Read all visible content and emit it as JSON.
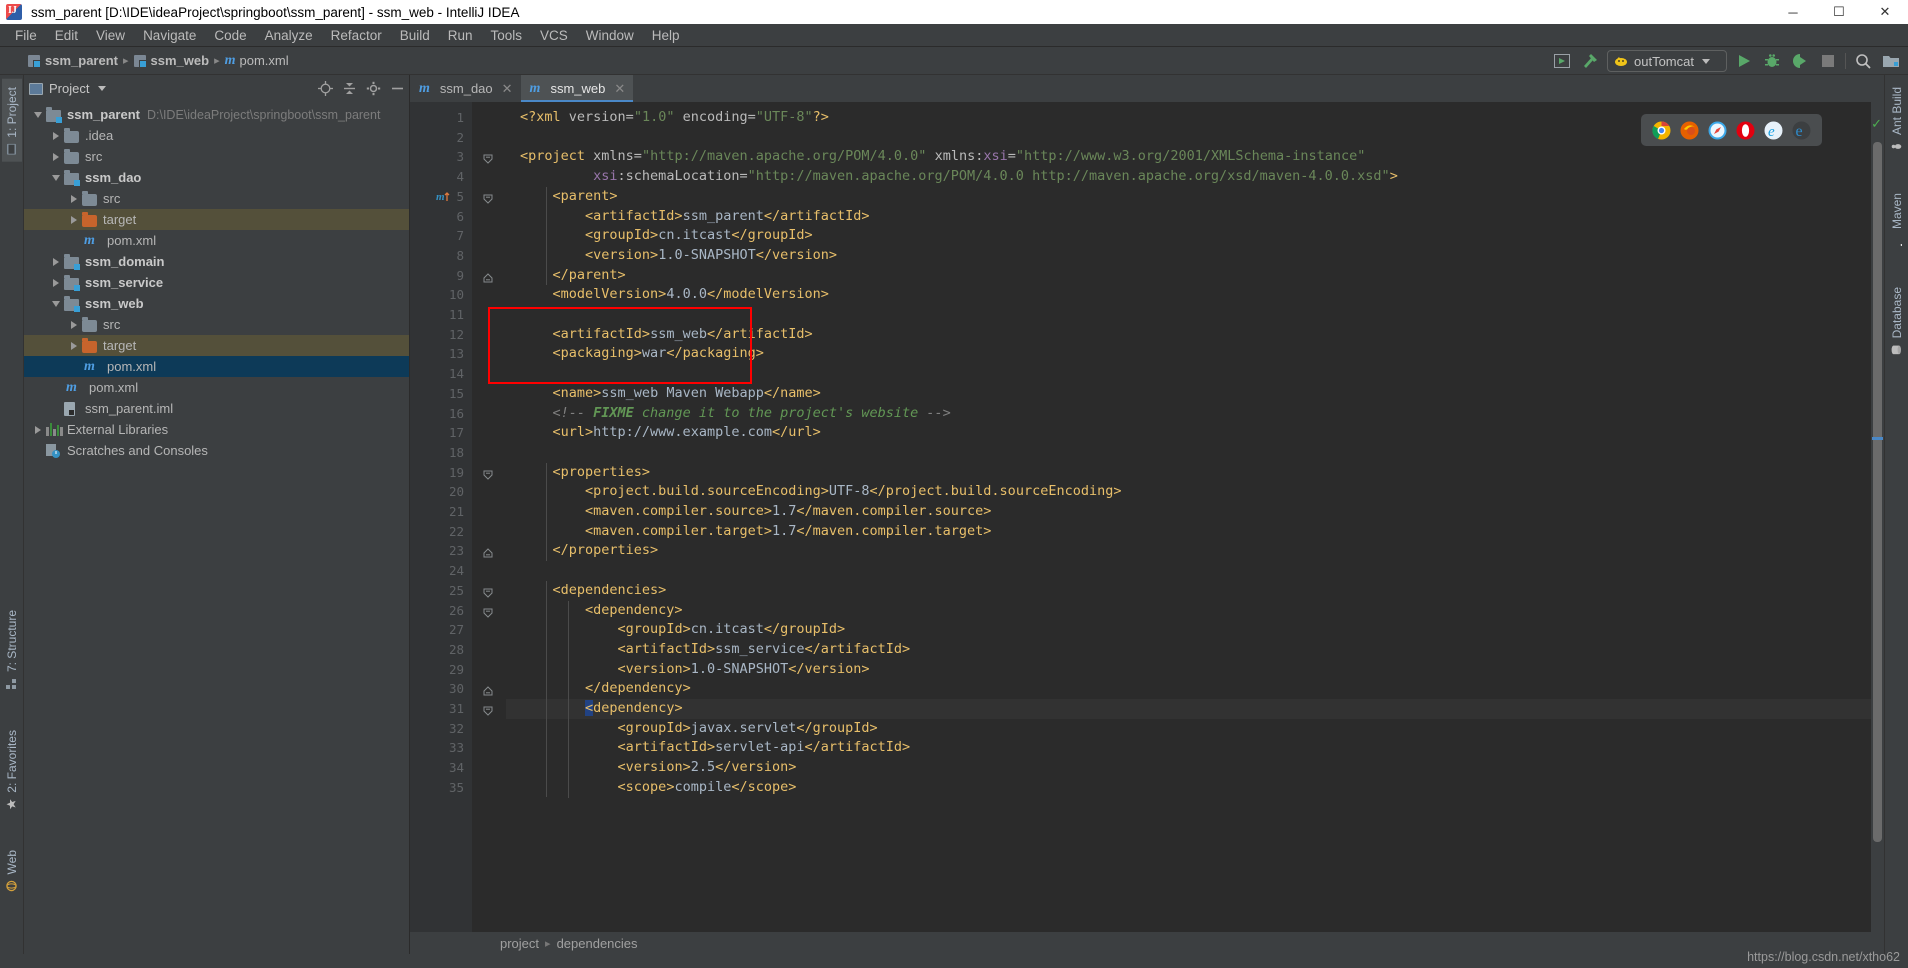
{
  "window": {
    "title": "ssm_parent [D:\\IDE\\ideaProject\\springboot\\ssm_parent] - ssm_web - IntelliJ IDEA",
    "minimize": "─",
    "maximize": "☐",
    "close": "✕"
  },
  "menubar": {
    "items": [
      "File",
      "Edit",
      "View",
      "Navigate",
      "Code",
      "Analyze",
      "Refactor",
      "Build",
      "Run",
      "Tools",
      "VCS",
      "Window",
      "Help"
    ]
  },
  "navbar": {
    "crumbs": [
      "ssm_parent",
      "ssm_web",
      "pom.xml"
    ],
    "run_config": "outTomcat"
  },
  "project_panel": {
    "header_label": "Project",
    "tree": [
      {
        "indent": 0,
        "arrow": "open",
        "icon": "module",
        "label": "ssm_parent",
        "bold": true,
        "path": "D:\\IDE\\ideaProject\\springboot\\ssm_parent",
        "state": "normal"
      },
      {
        "indent": 1,
        "arrow": "closed",
        "icon": "folder",
        "label": ".idea",
        "bold": false,
        "path": "",
        "state": "normal"
      },
      {
        "indent": 1,
        "arrow": "closed",
        "icon": "folder",
        "label": "src",
        "bold": false,
        "path": "",
        "state": "normal"
      },
      {
        "indent": 1,
        "arrow": "open",
        "icon": "module",
        "label": "ssm_dao",
        "bold": true,
        "path": "",
        "state": "normal"
      },
      {
        "indent": 2,
        "arrow": "closed",
        "icon": "folder",
        "label": "src",
        "bold": false,
        "path": "",
        "state": "normal"
      },
      {
        "indent": 2,
        "arrow": "closed",
        "icon": "folder-orange",
        "label": "target",
        "bold": false,
        "path": "",
        "state": "target"
      },
      {
        "indent": 2,
        "arrow": "none",
        "icon": "maven",
        "label": "pom.xml",
        "bold": false,
        "path": "",
        "state": "normal"
      },
      {
        "indent": 1,
        "arrow": "closed",
        "icon": "module",
        "label": "ssm_domain",
        "bold": true,
        "path": "",
        "state": "normal"
      },
      {
        "indent": 1,
        "arrow": "closed",
        "icon": "module",
        "label": "ssm_service",
        "bold": true,
        "path": "",
        "state": "normal"
      },
      {
        "indent": 1,
        "arrow": "open",
        "icon": "module",
        "label": "ssm_web",
        "bold": true,
        "path": "",
        "state": "normal"
      },
      {
        "indent": 2,
        "arrow": "closed",
        "icon": "folder",
        "label": "src",
        "bold": false,
        "path": "",
        "state": "normal"
      },
      {
        "indent": 2,
        "arrow": "closed",
        "icon": "folder-orange",
        "label": "target",
        "bold": false,
        "path": "",
        "state": "target"
      },
      {
        "indent": 2,
        "arrow": "none",
        "icon": "maven",
        "label": "pom.xml",
        "bold": false,
        "path": "",
        "state": "selected"
      },
      {
        "indent": 1,
        "arrow": "none",
        "icon": "maven",
        "label": "pom.xml",
        "bold": false,
        "path": "",
        "state": "normal"
      },
      {
        "indent": 1,
        "arrow": "none",
        "icon": "iml",
        "label": "ssm_parent.iml",
        "bold": false,
        "path": "",
        "state": "normal"
      },
      {
        "indent": 0,
        "arrow": "closed",
        "icon": "library",
        "label": "External Libraries",
        "bold": false,
        "path": "",
        "state": "normal"
      },
      {
        "indent": 0,
        "arrow": "none",
        "icon": "scratch",
        "label": "Scratches and Consoles",
        "bold": false,
        "path": "",
        "state": "normal"
      }
    ]
  },
  "editor": {
    "tabs": [
      {
        "label": "ssm_dao",
        "active": false
      },
      {
        "label": "ssm_web",
        "active": true
      }
    ],
    "close_glyph": "✕",
    "lines": [
      {
        "n": 1,
        "html": "<span class='tagb'>&lt;?xml</span> <span class='attr'>version=</span><span class='str'>\"1.0\"</span> <span class='attr'>encoding=</span><span class='str'>\"UTF-8\"</span><span class='tagb'>?&gt;</span>",
        "indent": 0
      },
      {
        "n": 2,
        "html": "",
        "indent": 0
      },
      {
        "n": 3,
        "html": "<span class='tagb'>&lt;project</span> <span class='attr'>xmlns=</span><span class='str'>\"http://maven.apache.org/POM/4.0.0\"</span> <span class='attr'>xmlns:</span><span class='attrn'>xsi</span><span class='attr'>=</span><span class='str'>\"http://www.w3.org/2001/XMLSchema-instance\"</span>",
        "indent": 0,
        "fold": "open"
      },
      {
        "n": 4,
        "html": "         <span class='attrn'>xsi</span><span class='attr'>:schemaLocation=</span><span class='str'>\"http://maven.apache.org/POM/4.0.0 http://maven.apache.org/xsd/maven-4.0.0.xsd\"</span><span class='tagb'>&gt;</span>",
        "indent": 0
      },
      {
        "n": 5,
        "html": "    <span class='tagb'>&lt;parent&gt;</span>",
        "indent": 0,
        "fold": "open",
        "marker": "maven"
      },
      {
        "n": 6,
        "html": "        <span class='tagb'>&lt;artifactId&gt;</span><span class='txt'>ssm_parent</span><span class='tagb'>&lt;/artifactId&gt;</span>",
        "indent": 0
      },
      {
        "n": 7,
        "html": "        <span class='tagb'>&lt;groupId&gt;</span><span class='txt'>cn.itcast</span><span class='tagb'>&lt;/groupId&gt;</span>",
        "indent": 0
      },
      {
        "n": 8,
        "html": "        <span class='tagb'>&lt;version&gt;</span><span class='txt'>1.0-SNAPSHOT</span><span class='tagb'>&lt;/version&gt;</span>",
        "indent": 0
      },
      {
        "n": 9,
        "html": "    <span class='tagb'>&lt;/parent&gt;</span>",
        "indent": 0,
        "fold": "close"
      },
      {
        "n": 10,
        "html": "    <span class='tagb'>&lt;modelVersion&gt;</span><span class='txt'>4.0.0</span><span class='tagb'>&lt;/modelVersion&gt;</span>",
        "indent": 0
      },
      {
        "n": 11,
        "html": "",
        "indent": 0
      },
      {
        "n": 12,
        "html": "    <span class='tagb'>&lt;artifactId&gt;</span><span class='txt'>ssm_web</span><span class='tagb'>&lt;/artifactId&gt;</span>",
        "indent": 0
      },
      {
        "n": 13,
        "html": "    <span class='tagb'>&lt;packaging&gt;</span><span class='txt'>war</span><span class='tagb'>&lt;/packaging&gt;</span>",
        "indent": 0
      },
      {
        "n": 14,
        "html": "",
        "indent": 0
      },
      {
        "n": 15,
        "html": "    <span class='tagb'>&lt;name&gt;</span><span class='txt'>ssm_web Maven Webapp</span><span class='tagb'>&lt;/name&gt;</span>",
        "indent": 0
      },
      {
        "n": 16,
        "html": "    <span class='cmtb'>&lt;!-- </span><span class='fixme'>FIXME</span><span class='cmt'> change it to the project's website </span><span class='cmtb'>--&gt;</span>",
        "indent": 0
      },
      {
        "n": 17,
        "html": "    <span class='tagb'>&lt;url&gt;</span><span class='txt'>http://www.example.com</span><span class='tagb'>&lt;/url&gt;</span>",
        "indent": 0
      },
      {
        "n": 18,
        "html": "",
        "indent": 0
      },
      {
        "n": 19,
        "html": "    <span class='tagb'>&lt;properties&gt;</span>",
        "indent": 0,
        "fold": "open"
      },
      {
        "n": 20,
        "html": "        <span class='tagb'>&lt;project.build.sourceEncoding&gt;</span><span class='txt'>UTF-8</span><span class='tagb'>&lt;/project.build.sourceEncoding&gt;</span>",
        "indent": 0
      },
      {
        "n": 21,
        "html": "        <span class='tagb'>&lt;maven.compiler.source&gt;</span><span class='txt'>1.7</span><span class='tagb'>&lt;/maven.compiler.source&gt;</span>",
        "indent": 0
      },
      {
        "n": 22,
        "html": "        <span class='tagb'>&lt;maven.compiler.target&gt;</span><span class='txt'>1.7</span><span class='tagb'>&lt;/maven.compiler.target&gt;</span>",
        "indent": 0
      },
      {
        "n": 23,
        "html": "    <span class='tagb'>&lt;/properties&gt;</span>",
        "indent": 0,
        "fold": "close"
      },
      {
        "n": 24,
        "html": "",
        "indent": 0
      },
      {
        "n": 25,
        "html": "    <span class='tagb'>&lt;dependencies&gt;</span>",
        "indent": 0,
        "fold": "open"
      },
      {
        "n": 26,
        "html": "        <span class='tagb'>&lt;dependency&gt;</span>",
        "indent": 0,
        "fold": "open"
      },
      {
        "n": 27,
        "html": "            <span class='tagb'>&lt;groupId&gt;</span><span class='txt'>cn.itcast</span><span class='tagb'>&lt;/groupId&gt;</span>",
        "indent": 0
      },
      {
        "n": 28,
        "html": "            <span class='tagb'>&lt;artifactId&gt;</span><span class='txt'>ssm_service</span><span class='tagb'>&lt;/artifactId&gt;</span>",
        "indent": 0
      },
      {
        "n": 29,
        "html": "            <span class='tagb'>&lt;version&gt;</span><span class='txt'>1.0-SNAPSHOT</span><span class='tagb'>&lt;/version&gt;</span>",
        "indent": 0
      },
      {
        "n": 30,
        "html": "        <span class='tagb'>&lt;/dependency&gt;</span>",
        "indent": 0,
        "fold": "close"
      },
      {
        "n": 31,
        "html": "        <span class='hl-sel tagb'>&lt;</span><span class='tagb'>dependency&gt;</span>",
        "indent": 0,
        "fold": "open",
        "current": true,
        "bulb": true
      },
      {
        "n": 32,
        "html": "            <span class='tagb'>&lt;groupId&gt;</span><span class='txt'>javax.servlet</span><span class='tagb'>&lt;/groupId&gt;</span>",
        "indent": 0
      },
      {
        "n": 33,
        "html": "            <span class='tagb'>&lt;artifactId&gt;</span><span class='txt'>servlet-api</span><span class='tagb'>&lt;/artifactId&gt;</span>",
        "indent": 0
      },
      {
        "n": 34,
        "html": "            <span class='tagb'>&lt;version&gt;</span><span class='txt'>2.5</span><span class='tagb'>&lt;/version&gt;</span>",
        "indent": 0
      },
      {
        "n": 35,
        "html": "            <span class='tagb'>&lt;scope&gt;</span><span class='txt'>compile</span><span class='tagb'>&lt;/scope&gt;</span>",
        "indent": 0
      }
    ],
    "breadcrumb": [
      "project",
      "dependencies"
    ],
    "browsers": [
      "chrome-icon",
      "firefox-icon",
      "safari-icon",
      "opera-icon",
      "internet-explorer-icon",
      "edge-icon"
    ]
  },
  "left_rail": {
    "tabs": [
      {
        "label": "1: Project",
        "icon": "project-icon",
        "active": true
      },
      {
        "label": "7: Structure",
        "icon": "structure-icon",
        "active": false
      },
      {
        "label": "2: Favorites",
        "icon": "favorites-icon",
        "active": false
      },
      {
        "label": "Web",
        "icon": "web-icon",
        "active": false
      }
    ]
  },
  "right_rail": {
    "tabs": [
      {
        "label": "Ant Build",
        "icon": "ant-icon"
      },
      {
        "label": "Maven",
        "icon": "maven-icon"
      },
      {
        "label": "Database",
        "icon": "database-icon"
      }
    ]
  },
  "watermark": "https://blog.csdn.net/xtho62",
  "colors": {
    "accent": "#4a88c7",
    "highlight_box": "#ff0000",
    "selection": "#0d3a58",
    "target_row": "#54503a",
    "editor_bg": "#2b2b2b",
    "panel_bg": "#3c3f41"
  }
}
